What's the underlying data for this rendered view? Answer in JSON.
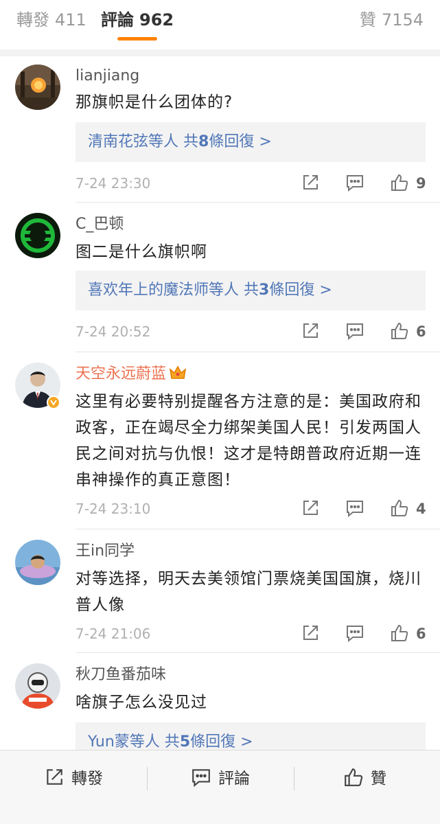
{
  "tabs": {
    "repost": {
      "label": "轉發",
      "count": "411"
    },
    "comments": {
      "label": "評論",
      "count": "962"
    },
    "likes": {
      "label": "贊",
      "count": "7154"
    }
  },
  "colors": {
    "accent": "#ff8200",
    "link": "#5177b7",
    "vip_name": "#eb7350"
  },
  "comments": [
    {
      "username": "lianjiang",
      "text": "那旗帜是什么团体的?",
      "reply": {
        "names": "清南花弦",
        "middle": "等人 共",
        "count": "8",
        "suffix": "條回復 >"
      },
      "time": "7-24 23:30",
      "likes": "9"
    },
    {
      "username": "C_巴顿",
      "text": "图二是什么旗帜啊",
      "reply": {
        "names": "喜欢年上的魔法师",
        "middle": "等人 共",
        "count": "3",
        "suffix": "條回復 >"
      },
      "time": "7-24 20:52",
      "likes": "6"
    },
    {
      "username": "天空永远蔚蓝",
      "text": "这里有必要特别提醒各方注意的是：美国政府和政客，正在竭尽全力绑架美国人民！引发两国人民之间对抗与仇恨！这才是特朗普政府近期一连串神操作的真正意图！",
      "time": "7-24 23:10",
      "likes": "4"
    },
    {
      "username": "王in同学",
      "text": "对等选择，明天去美领馆门票烧美国国旗，烧川普人像",
      "time": "7-24 21:06",
      "likes": "6"
    },
    {
      "username": "秋刀鱼番茄味",
      "text": "啥旗子怎么没见过",
      "reply": {
        "names": "Yun蒙",
        "middle": "等人 共",
        "count": "5",
        "suffix": "條回復 >"
      }
    }
  ],
  "bottom_bar": {
    "repost": "轉發",
    "comment": "評論",
    "like": "贊"
  }
}
